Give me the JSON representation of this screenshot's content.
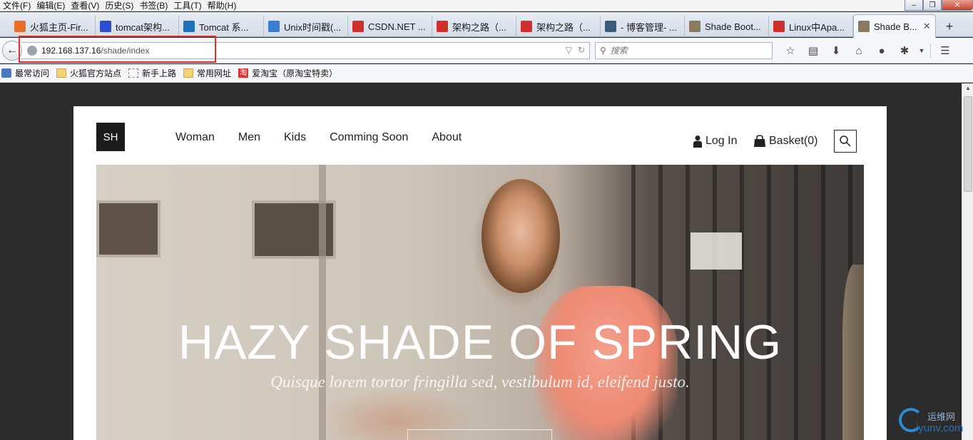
{
  "menubar": {
    "items": [
      "文件(F)",
      "编辑(E)",
      "查看(V)",
      "历史(S)",
      "书签(B)",
      "工具(T)",
      "帮助(H)"
    ],
    "window_controls": [
      "–",
      "❐",
      "✕"
    ]
  },
  "tabs": [
    {
      "title": "火狐主页-Fir...",
      "icon": "firefox-icon",
      "color": "#e8702a"
    },
    {
      "title": "tomcat架构...",
      "icon": "baidu-paw-icon",
      "color": "#2b4fd0"
    },
    {
      "title": "Tomcat 系...",
      "icon": "ibm-icon",
      "color": "#1f70c1"
    },
    {
      "title": "Unix时间戳(...",
      "icon": "page-icon",
      "color": "#3a7bd5"
    },
    {
      "title": "CSDN.NET ...",
      "icon": "csdn-icon",
      "color": "#d0302b"
    },
    {
      "title": "架构之路（...",
      "icon": "csdn-icon",
      "color": "#d0302b"
    },
    {
      "title": "架构之路（...",
      "icon": "csdn-icon",
      "color": "#d0302b"
    },
    {
      "title": "- 博客管理- ...",
      "icon": "cnblogs-icon",
      "color": "#3a5a7a"
    },
    {
      "title": "Shade Boot...",
      "icon": "site-icon",
      "color": "#8a7a60"
    },
    {
      "title": "Linux中Apa...",
      "icon": "csdn-icon",
      "color": "#d0302b"
    },
    {
      "title": "Shade B...",
      "icon": "site-icon",
      "color": "#8a7a60",
      "active": true
    }
  ],
  "navbar": {
    "url_host": "192.168.137.16",
    "url_path": "/shade/index",
    "search_placeholder": "搜索"
  },
  "bookmarks": [
    {
      "label": "最常访问",
      "icon": "star-icon"
    },
    {
      "label": "火狐官方站点",
      "icon": "folder-icon"
    },
    {
      "label": "新手上路",
      "icon": "blank-page-icon"
    },
    {
      "label": "常用网址",
      "icon": "folder-icon"
    },
    {
      "label": "爱淘宝（原淘宝特卖）",
      "icon": "taobao-icon",
      "badge": "淘"
    }
  ],
  "site": {
    "logo": "SH",
    "nav": [
      "Woman",
      "Men",
      "Kids",
      "Comming Soon",
      "About"
    ],
    "login": "Log In",
    "basket": "Basket(0)",
    "hero_title": "HAZY SHADE OF SPRING",
    "hero_subtitle": "Quisque lorem tortor fringilla sed, vestibulum id, eleifend justo."
  },
  "watermark": {
    "line1": "运维网",
    "line2": "iyunv.com"
  },
  "colors": {
    "annotation_red": "#e0302b",
    "page_bg": "#2c2c2c",
    "logo_bg": "#1b1b1b"
  }
}
